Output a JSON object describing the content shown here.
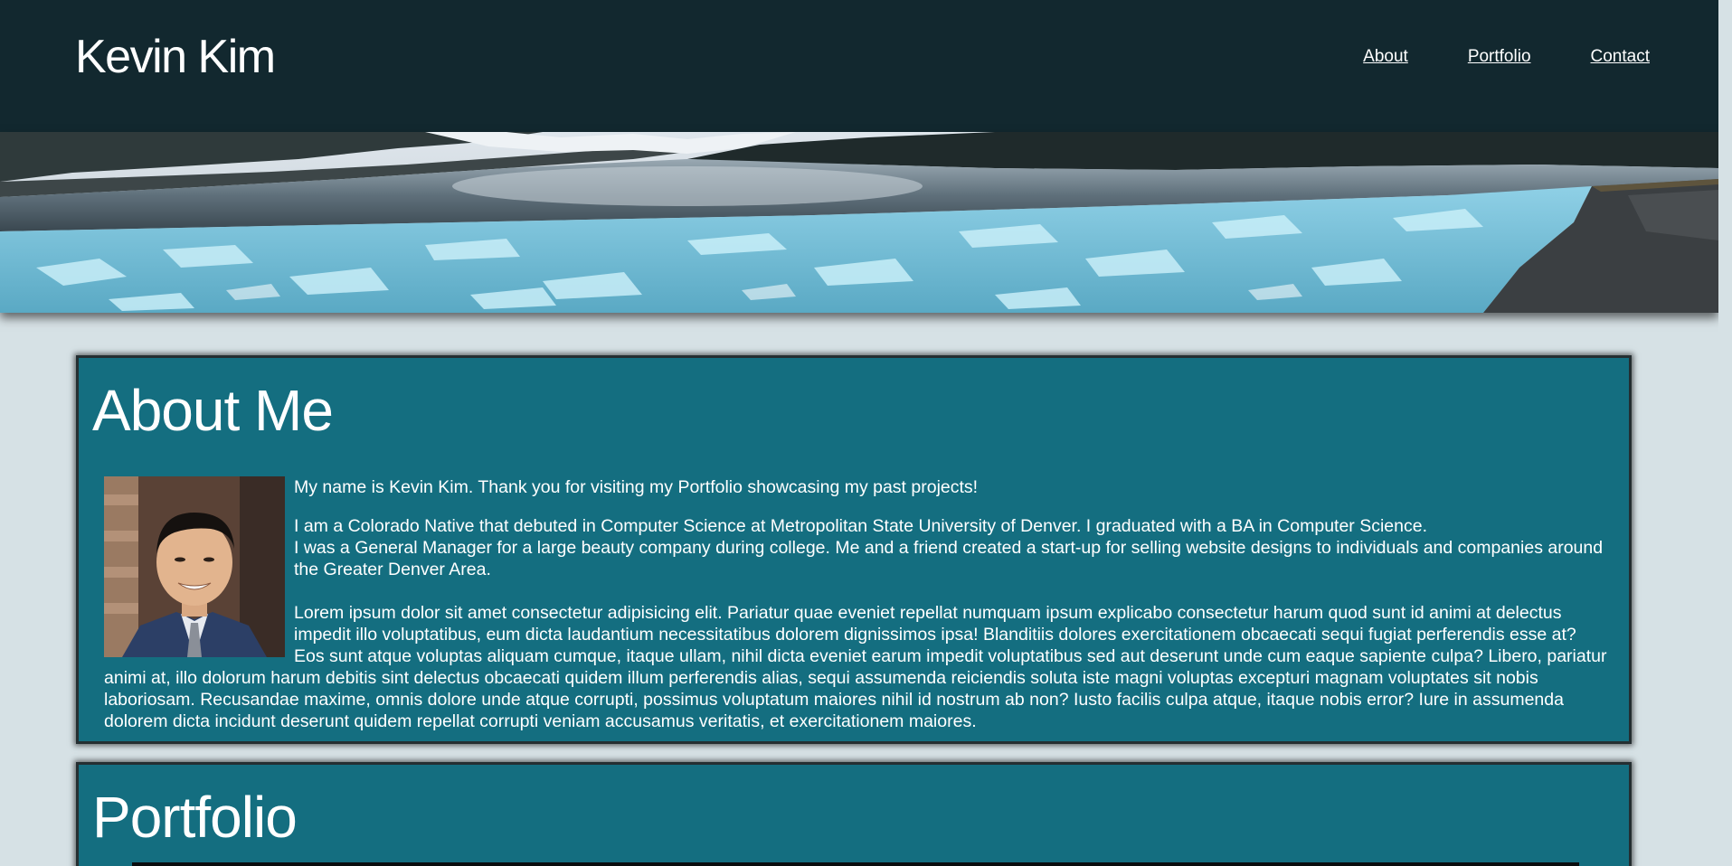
{
  "header": {
    "site_title": "Kevin Kim",
    "nav": [
      {
        "label": "About"
      },
      {
        "label": "Portfolio"
      },
      {
        "label": "Contact"
      }
    ]
  },
  "about": {
    "title": "About Me",
    "intro": "My name is Kevin Kim. Thank you for visiting my Portfolio showcasing my past projects!",
    "bio_line1": "I am a Colorado Native that debuted in Computer Science at Metropolitan State University of Denver. I graduated with a BA in Computer Science.",
    "bio_line2": "I was a General Manager for a large beauty company during college. Me and a friend created a start-up for selling website designs to individuals and companies around the Greater Denver Area.",
    "lorem": "Lorem ipsum dolor sit amet consectetur adipisicing elit. Pariatur quae eveniet repellat numquam ipsum explicabo consectetur harum quod sunt id animi at delectus impedit illo voluptatibus, eum dicta laudantium necessitatibus dolorem dignissimos ipsa! Blanditiis dolores exercitationem obcaecati sequi fugiat perferendis esse at? Eos sunt atque voluptas aliquam cumque, itaque ullam, nihil dicta eveniet earum impedit voluptatibus sed aut deserunt unde cum eaque sapiente culpa? Libero, pariatur animi at, illo dolorum harum debitis sint delectus obcaecati quidem illum perferendis alias, sequi assumenda reiciendis soluta iste magni voluptas excepturi magnam voluptates sit nobis laboriosam. Recusandae maxime, omnis dolore unde atque corrupti, possimus voluptatum maiores nihil id nostrum ab non? Iusto facilis culpa atque, itaque nobis error? Iure in assumenda dolorem dicta incidunt deserunt quidem repellat corrupti veniam accusamus veritatis, et exercitationem maiores."
  },
  "portfolio": {
    "title": "Portfolio"
  },
  "colors": {
    "header_bg": "#12282f",
    "page_bg": "#d6e1e5",
    "section_bg": "#146e80",
    "text": "#ffffff"
  }
}
